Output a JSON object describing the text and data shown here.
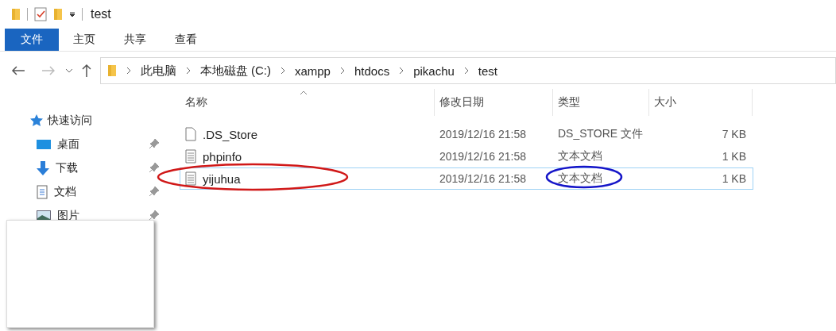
{
  "window": {
    "title": "test"
  },
  "ribbon": {
    "tabs": [
      {
        "label": "文件",
        "selected": true
      },
      {
        "label": "主页",
        "selected": false
      },
      {
        "label": "共享",
        "selected": false
      },
      {
        "label": "查看",
        "selected": false
      }
    ]
  },
  "address_bar": {
    "path": [
      "此电脑",
      "本地磁盘 (C:)",
      "xampp",
      "htdocs",
      "pikachu",
      "test"
    ]
  },
  "sidebar": {
    "section": "快速访问",
    "items": [
      {
        "label": "桌面",
        "kind": "desktop"
      },
      {
        "label": "下载",
        "kind": "download"
      },
      {
        "label": "文档",
        "kind": "document"
      },
      {
        "label": "图片",
        "kind": "picture"
      }
    ]
  },
  "table": {
    "columns": [
      "名称",
      "修改日期",
      "类型",
      "大小"
    ],
    "rows": [
      {
        "name": ".DS_Store",
        "kind": "blank",
        "modified": "2019/12/16 21:58",
        "type": "DS_STORE 文件",
        "size": "7 KB",
        "selected": false
      },
      {
        "name": "phpinfo",
        "kind": "text",
        "modified": "2019/12/16 21:58",
        "type": "文本文档",
        "size": "1 KB",
        "selected": false
      },
      {
        "name": "yijuhua",
        "kind": "text",
        "modified": "2019/12/16 21:58",
        "type": "文本文档",
        "size": "1 KB",
        "selected": true
      }
    ]
  }
}
